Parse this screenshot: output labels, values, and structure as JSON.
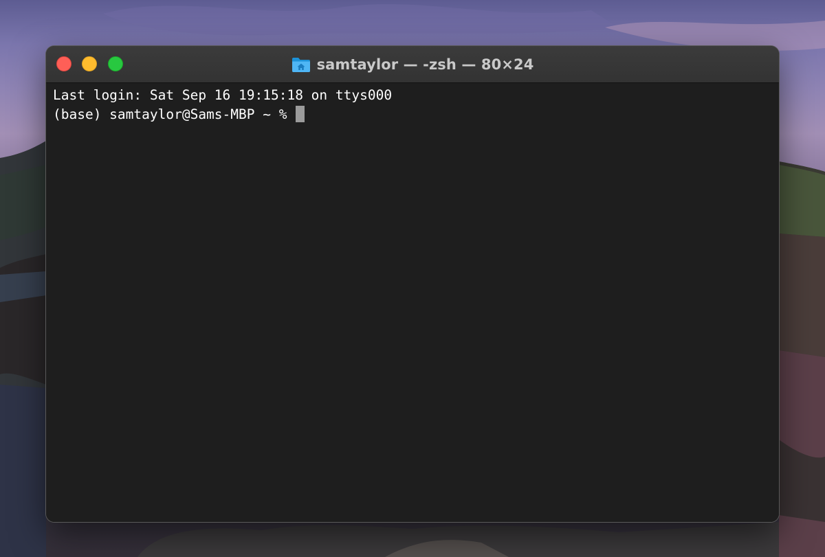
{
  "window": {
    "title": "samtaylor — -zsh — 80×24",
    "title_icon": "home-folder-icon",
    "traffic_lights": {
      "close": "#fe5f57",
      "minimize": "#febc2e",
      "zoom": "#28c840"
    }
  },
  "terminal": {
    "lines": [
      "Last login: Sat Sep 16 19:15:18 on ttys000"
    ],
    "prompt": "(base) samtaylor@Sams-MBP ~ % ",
    "cursor": "block",
    "background": "#1e1e1e",
    "foreground": "#ffffff"
  },
  "desktop": {
    "wallpaper": "macos-catalina-landscape"
  }
}
